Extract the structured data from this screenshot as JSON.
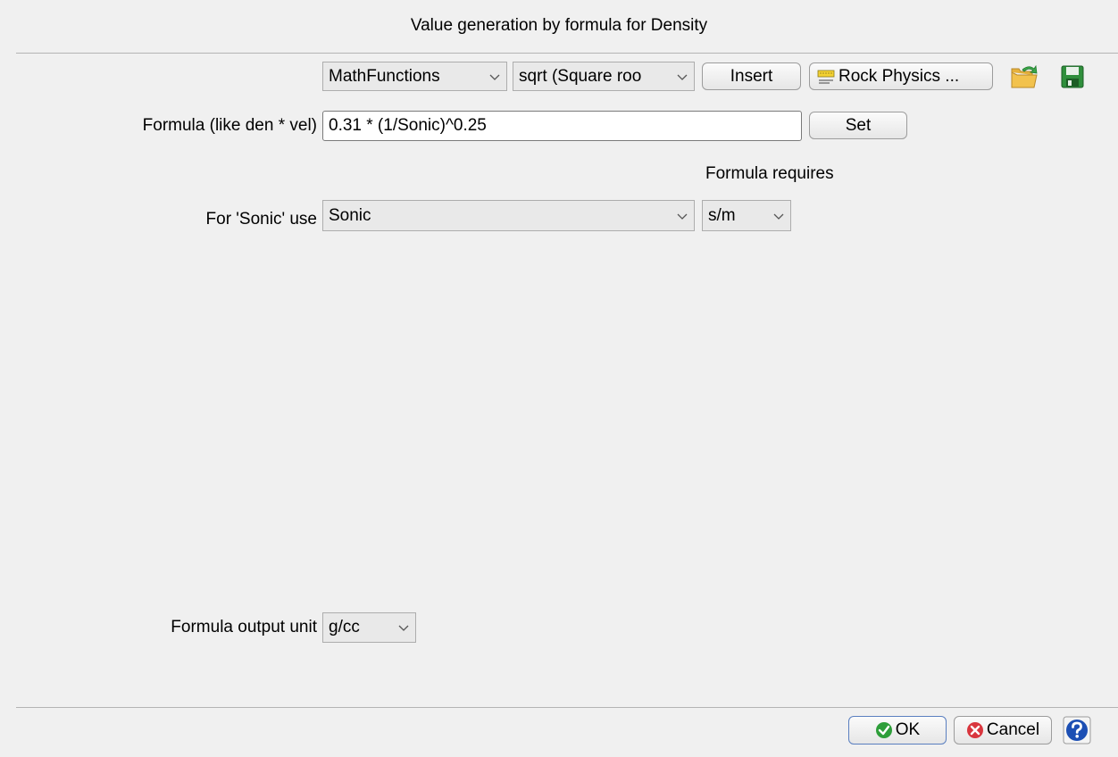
{
  "window": {
    "title": "Value generation by formula for Density"
  },
  "toolbar": {
    "category_select": "MathFunctions",
    "function_select": "sqrt (Square roo",
    "insert_label": "Insert",
    "rock_physics_label": "Rock Physics ...",
    "open_icon": "open-folder-icon",
    "save_icon": "save-disk-icon"
  },
  "formula": {
    "label": "Formula (like den * vel)",
    "value": "0.31 * (1/Sonic)^0.25",
    "set_label": "Set"
  },
  "requires": {
    "header": "Formula requires",
    "inputs": [
      {
        "label": "For 'Sonic' use",
        "log_select": "Sonic",
        "unit_select": "s/m"
      }
    ]
  },
  "output": {
    "label": "Formula output unit",
    "unit_select": "g/cc"
  },
  "footer": {
    "ok_label": "OK",
    "cancel_label": "Cancel",
    "help_icon": "help-icon"
  },
  "colors": {
    "background": "#f0f0f0",
    "ok_green": "#2e9e3a",
    "cancel_red": "#d9363e",
    "help_blue": "#1c4fb4"
  }
}
